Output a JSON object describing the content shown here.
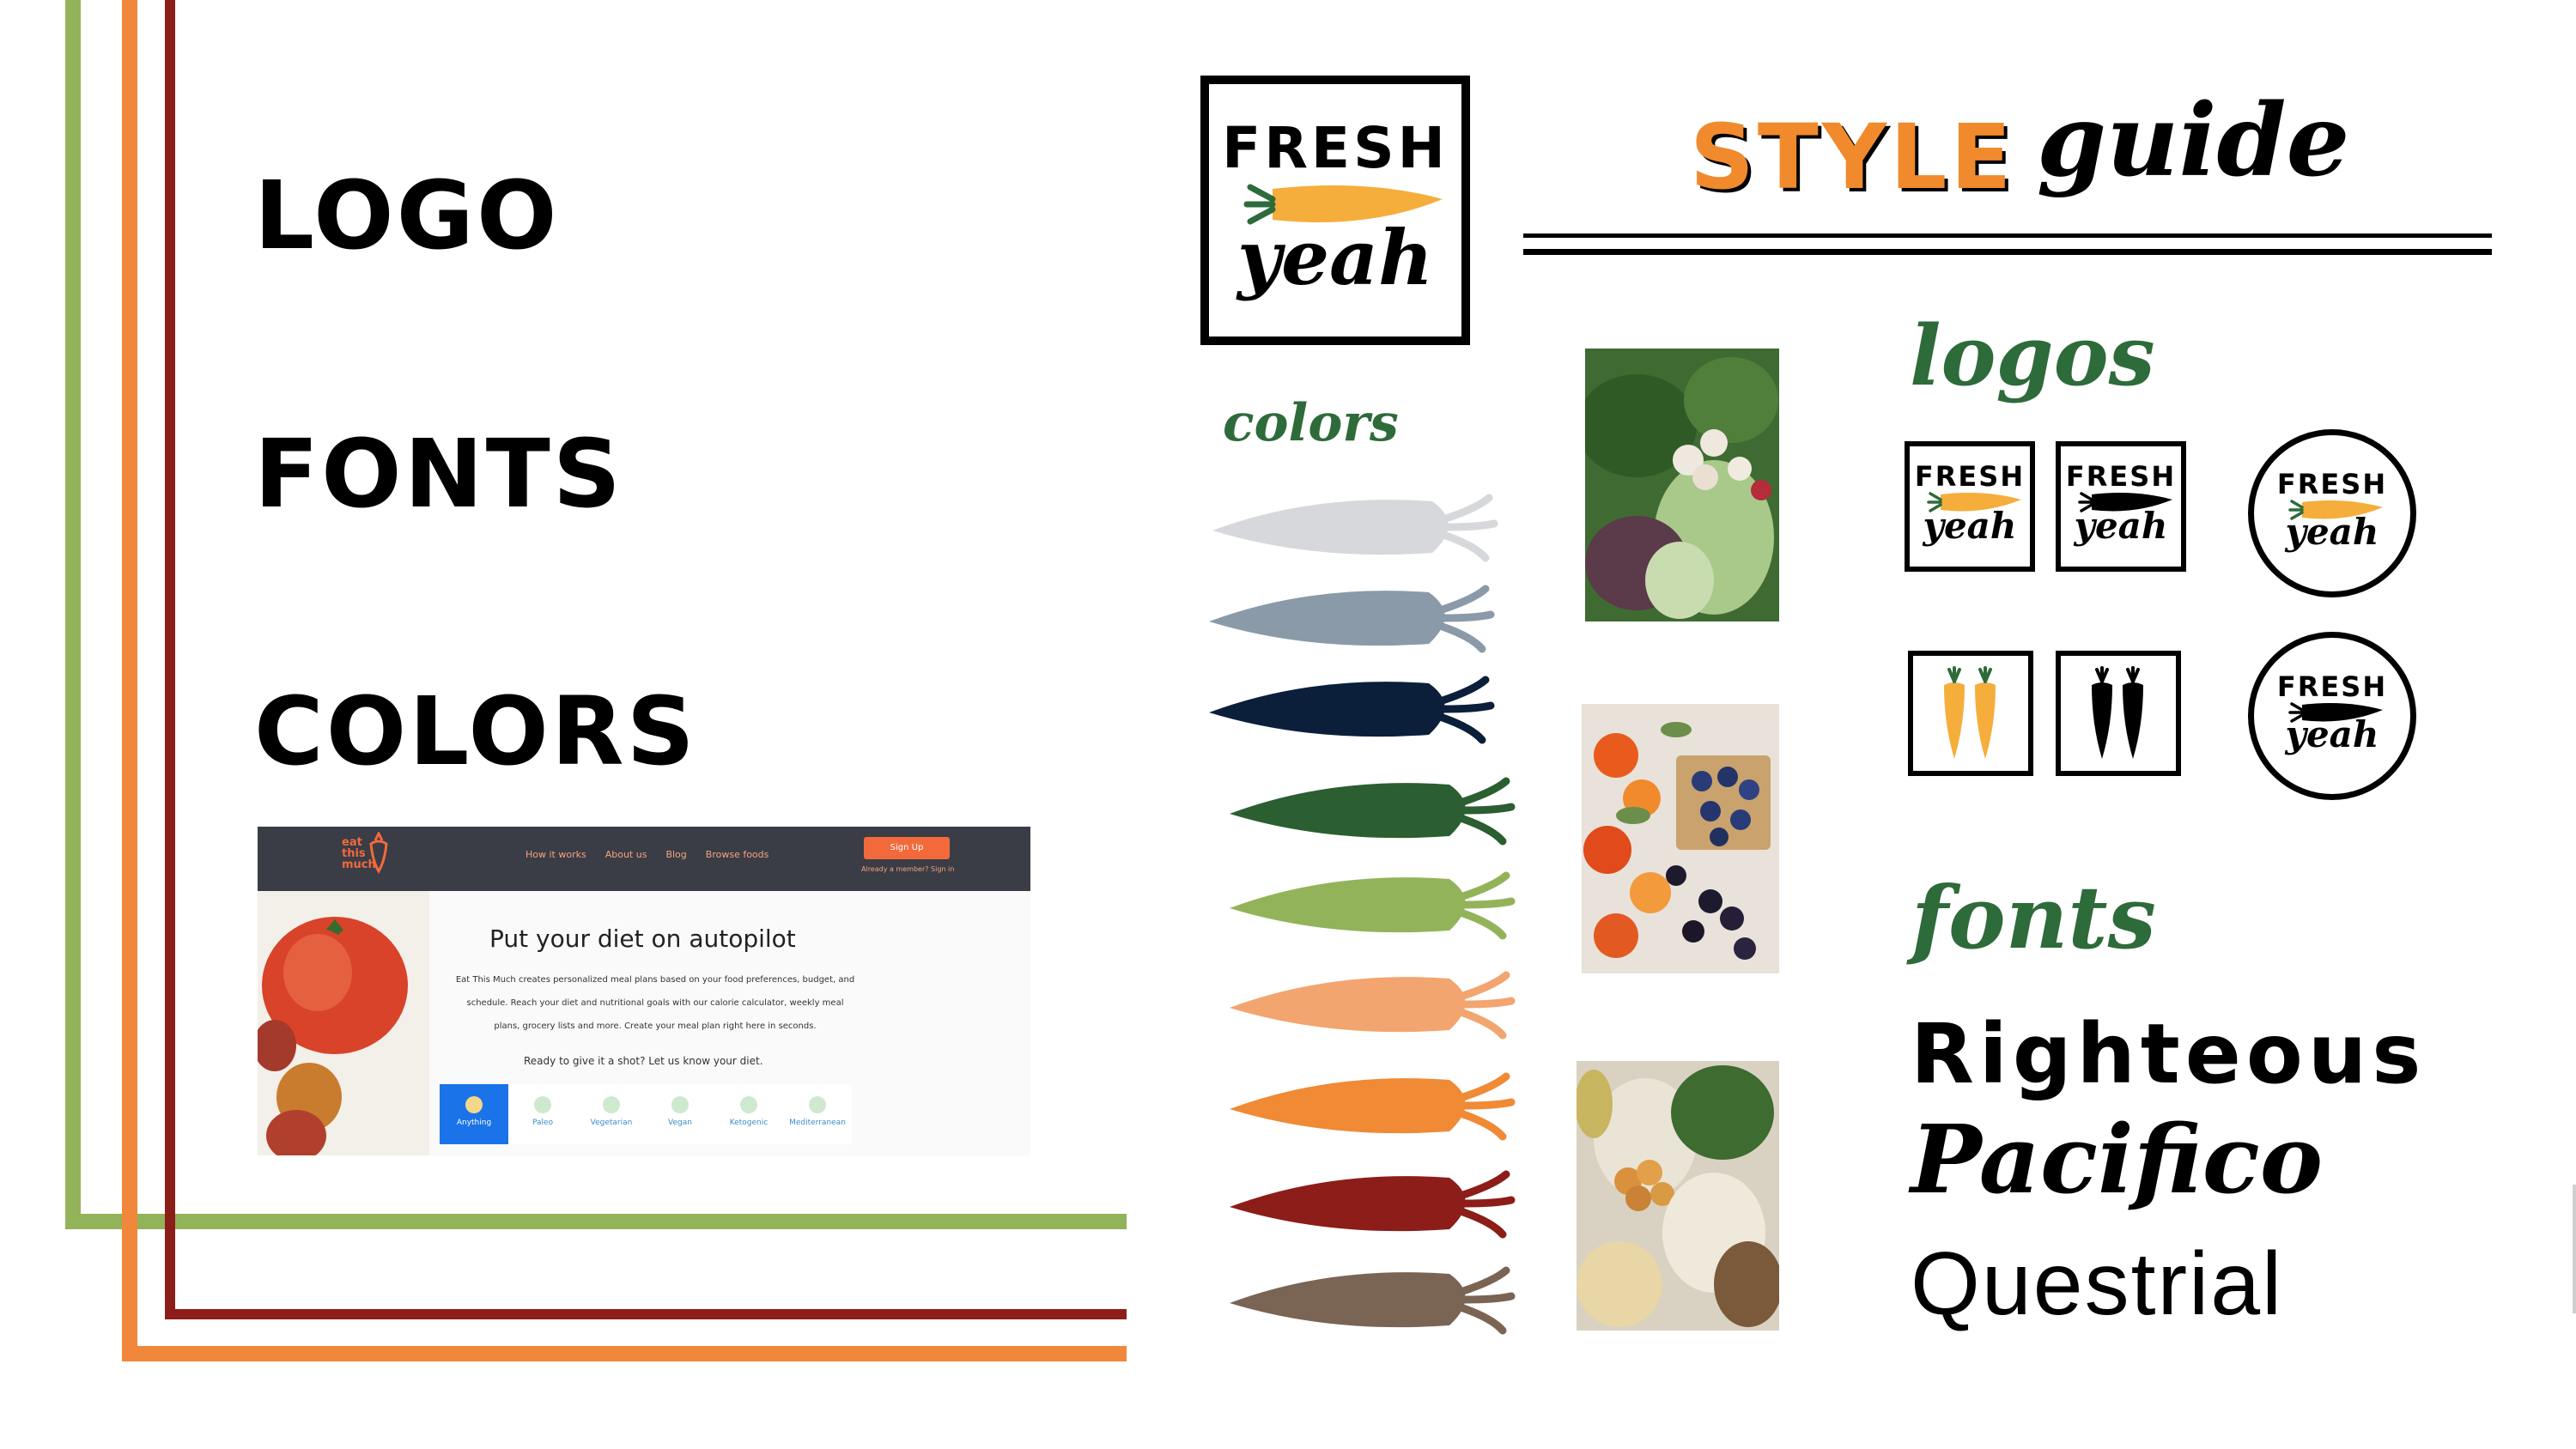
{
  "colors": {
    "green": "#93b35a",
    "orange": "#f0873a",
    "red": "#8c1d18",
    "black": "#000000",
    "script_green": "#2e6b3a",
    "style_orange": "#f08a2d"
  },
  "sections": {
    "logo": "LOGO",
    "fonts": "FONTS",
    "colors": "COLORS"
  },
  "screenshot": {
    "brand_line1": "eat",
    "brand_line2": "this",
    "brand_line3": "much",
    "nav": [
      "How it works",
      "About us",
      "Blog",
      "Browse foods"
    ],
    "signup": "Sign Up",
    "member": "Already a member? Sign in",
    "title": "Put your diet on autopilot",
    "body": "Eat This Much creates personalized meal plans based on your food preferences, budget, and schedule. Reach your diet and nutritional goals with our calorie calculator, weekly meal plans, grocery lists and more. Create your meal plan right here in seconds.",
    "ready": "Ready to give it a shot? Let us know your diet.",
    "diets": [
      "Anything",
      "Paleo",
      "Vegetarian",
      "Vegan",
      "Ketogenic",
      "Mediterranean"
    ]
  },
  "main_logo": {
    "fresh": "FRESH",
    "yeah": "yeah"
  },
  "title": {
    "style": "STYLE",
    "guide": "guide"
  },
  "labels": {
    "colors": "colors",
    "logos": "logos",
    "fonts": "fonts"
  },
  "swatches": [
    "#d6d8db",
    "#8a9aa8",
    "#0b1f3a",
    "#2b5e31",
    "#93b35a",
    "#f2a56e",
    "#f08a35",
    "#8c1d18",
    "#7a6454"
  ],
  "logo_variants": {
    "fresh": "FRESH",
    "yeah": "yeah"
  },
  "fonts": [
    "Righteous",
    "Pacifico",
    "Questrial"
  ]
}
